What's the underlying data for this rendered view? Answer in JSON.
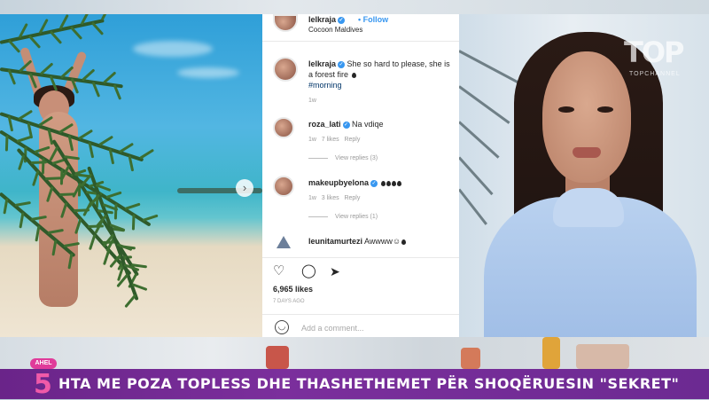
{
  "instagram": {
    "post_author": "lelkraja",
    "follow_label": "Follow",
    "location": "Cocoon Maldives",
    "caption_author": "lelkraja",
    "caption_text": "She so hard to please, she is a forest fire",
    "caption_hashtag": "#morning",
    "caption_age": "1w",
    "comments": [
      {
        "user": "roza_lati",
        "text": "Na vdiqe",
        "meta": "1w   7 likes   Reply",
        "replies": "View replies (3)"
      },
      {
        "user": "makeupbyelona",
        "text": "",
        "meta": "1w   3 likes   Reply",
        "replies": "View replies (1)"
      },
      {
        "user": "leunitamurtezi",
        "text": "Awwww",
        "meta": "",
        "replies": ""
      }
    ],
    "likes": "6,965 likes",
    "posted": "7 DAYS AGO",
    "add_comment_placeholder": "Add a comment..."
  },
  "channel_logo": {
    "text": "TOP",
    "subtext": "TOPCHANNEL"
  },
  "show_logo": {
    "pill": "AHEL",
    "number": "5"
  },
  "ticker": {
    "text": "HTA ME POZA TOPLESS DHE THASHETHEMET PËR SHOQËRUESIN \"SEKRET\""
  },
  "colors": {
    "ticker_bg": "#6a2489",
    "instagram_link": "#3897f0",
    "show_pink": "#e03b9a"
  },
  "icons": [
    "chevron-right-icon",
    "verified-badge-icon",
    "heart-icon",
    "comment-icon",
    "share-icon",
    "smiley-icon"
  ]
}
